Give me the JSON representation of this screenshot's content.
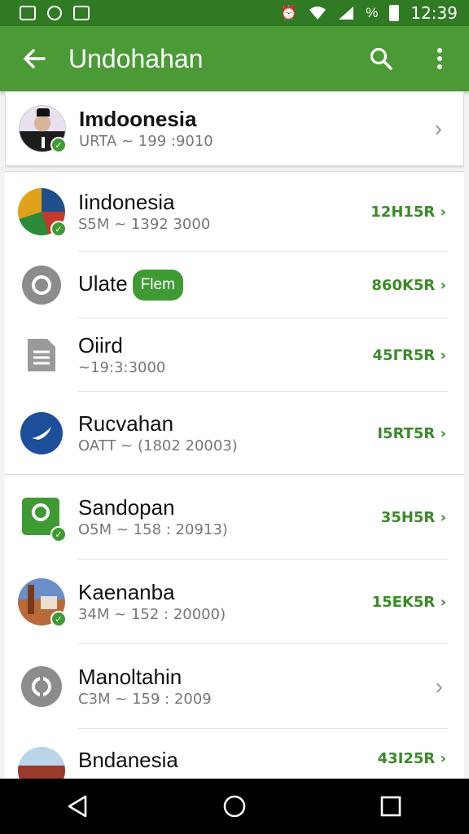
{
  "status_bar": {
    "time": "12:39",
    "battery_glyph": "%"
  },
  "app_bar": {
    "title": "Undohahan"
  },
  "header_item": {
    "title": "Imdoonesia",
    "subtitle": "URTA ~ 199 :9010"
  },
  "items": [
    {
      "title": "Iindonesia",
      "subtitle": "S5M ~ 1392 3000",
      "value": "12H15R"
    },
    {
      "title": "Ulate",
      "badge": "Flem",
      "subtitle": "",
      "value": "860K5R"
    },
    {
      "title": "Oiird",
      "subtitle": "~19:3:3000",
      "value": "45ГR5R"
    },
    {
      "title": "Rucvahan",
      "subtitle": "OATT ~ (1802 20003)",
      "value": "I5RT5R"
    },
    {
      "title": "Sandopan",
      "subtitle": "O5M ~ 158 : 20913)",
      "value": "35H5R"
    },
    {
      "title": "Kaenanba",
      "subtitle": "34M ~ 152 : 20000)",
      "value": "15EK5R"
    },
    {
      "title": "Manoltahin",
      "subtitle": "C3M ~ 159 : 2009",
      "value": ""
    },
    {
      "title": "Bndanesia",
      "subtitle": "",
      "value": "43I25R"
    }
  ],
  "colors": {
    "status_bar": "#2f7a23",
    "app_bar": "#4a9a36",
    "accent_green": "#3b8a2a",
    "badge": "#3f9a34"
  },
  "icons": [
    "back-arrow-icon",
    "search-icon",
    "more-vert-icon",
    "chevron-right-icon",
    "nav-back-icon",
    "nav-home-icon",
    "nav-recents-icon"
  ]
}
